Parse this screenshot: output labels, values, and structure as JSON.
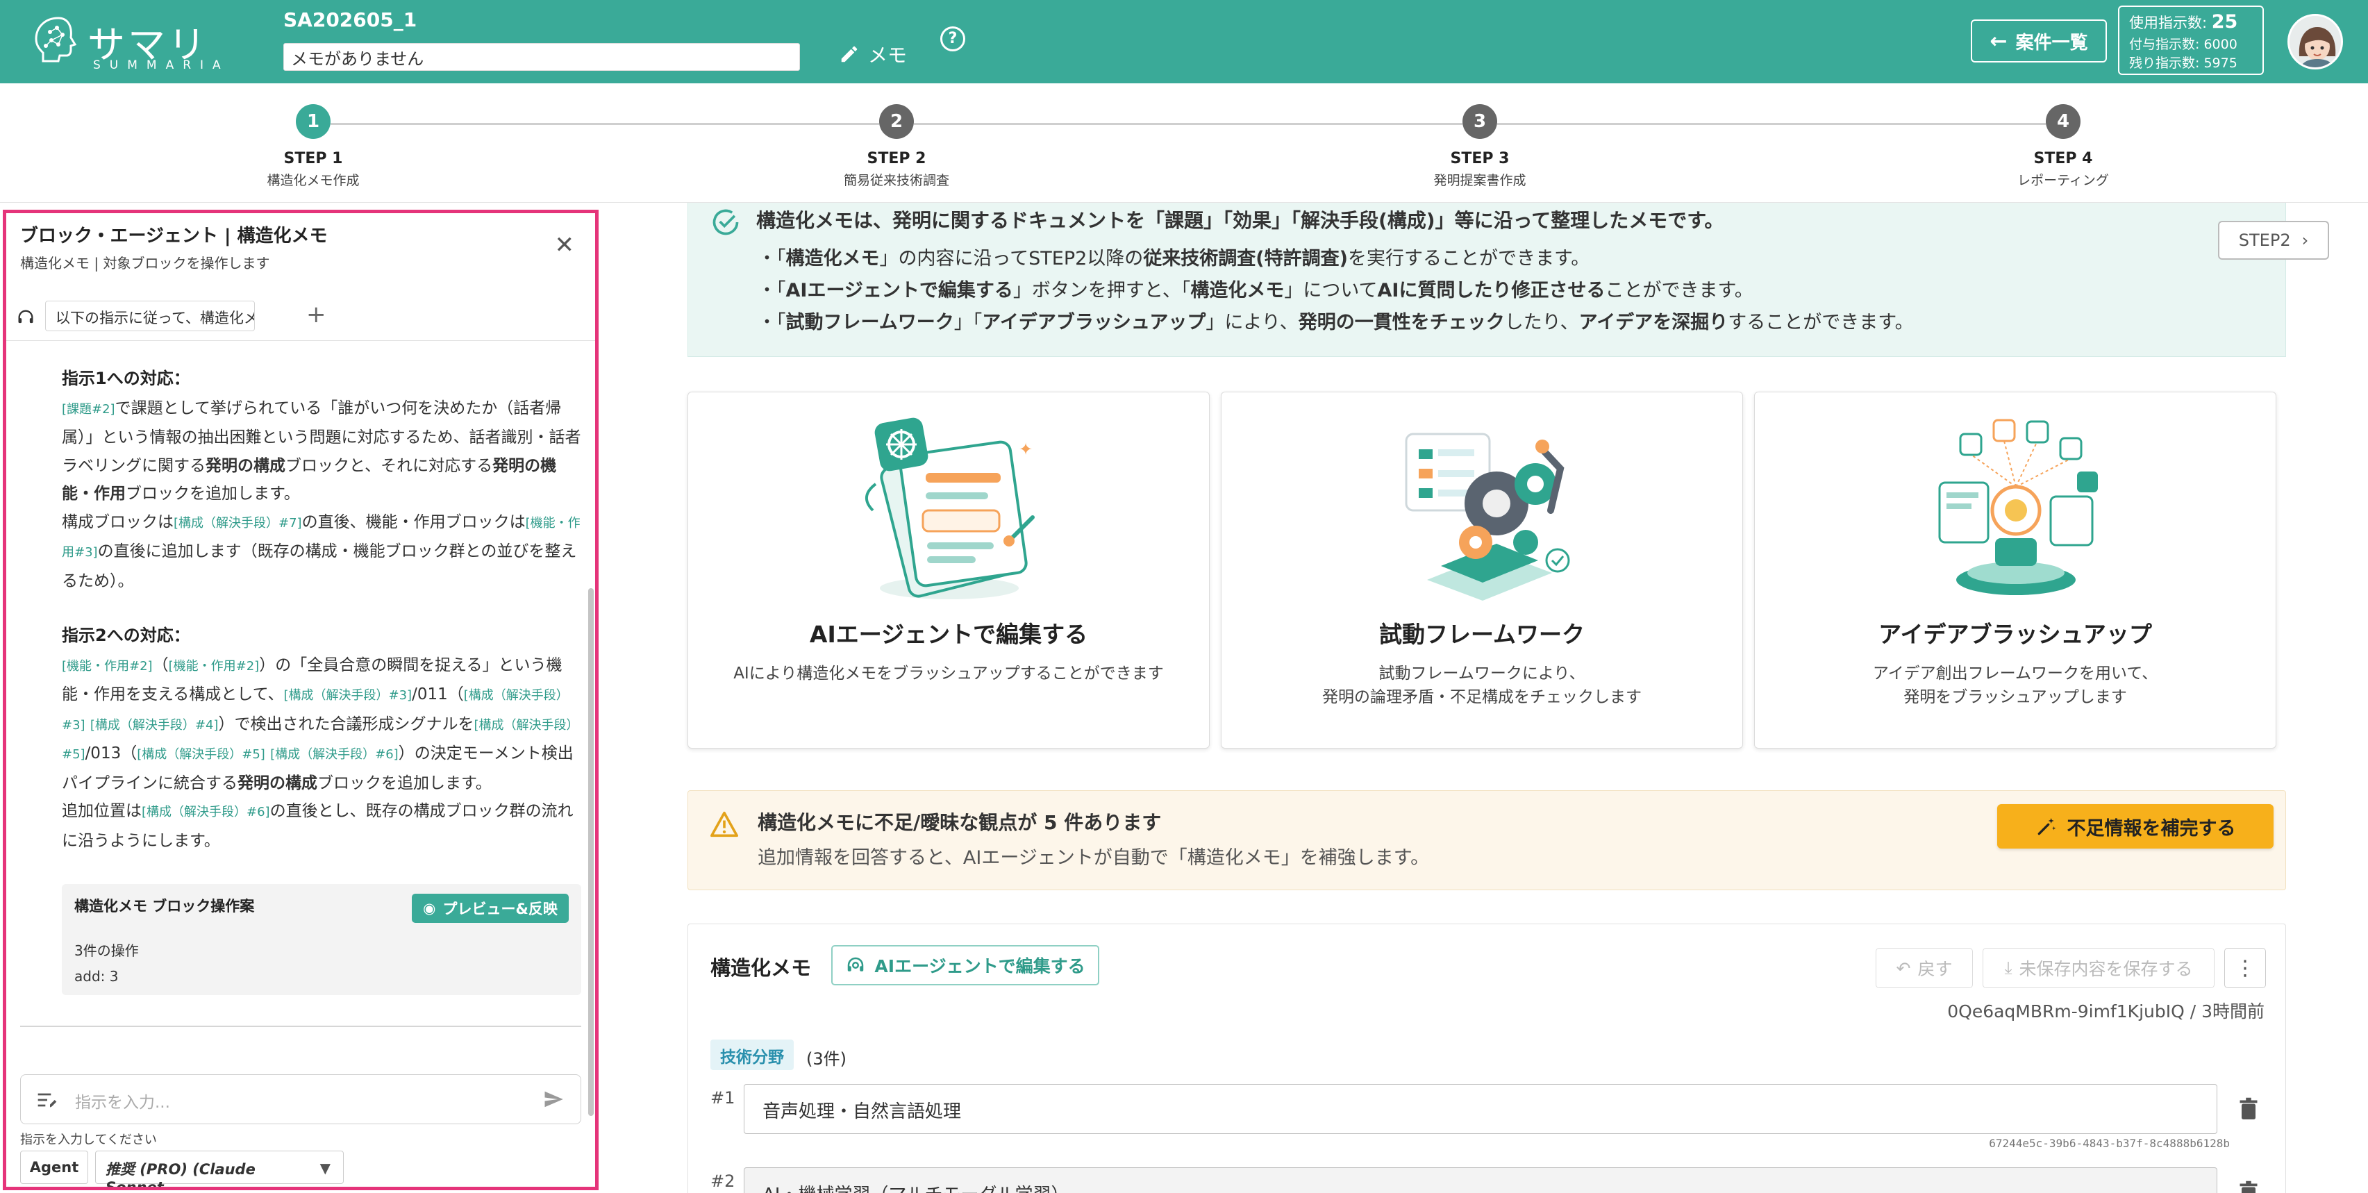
{
  "header": {
    "logo_text": "サマリア",
    "logo_sub": "SUMMARIA",
    "case_id": "SA202605_1",
    "memo_value": "メモがありません",
    "memo_button": "メモ",
    "cases_button": "案件一覧",
    "usage": {
      "used_label": "使用指示数:",
      "used_value": "25",
      "granted": "付与指示数: 6000",
      "remaining": "残り指示数: 5975"
    }
  },
  "steps": [
    {
      "num": "1",
      "title": "STEP 1",
      "sub": "構造化メモ作成"
    },
    {
      "num": "2",
      "title": "STEP 2",
      "sub": "簡易従来技術調査"
    },
    {
      "num": "3",
      "title": "STEP 3",
      "sub": "発明提案書作成"
    },
    {
      "num": "4",
      "title": "STEP 4",
      "sub": "レポーティング"
    }
  ],
  "panel": {
    "title": "ブロック・エージェント | 構造化メモ",
    "subtitle": "構造化メモ | 対象ブロックを操作します",
    "tab_label": "以下の指示に従って、構造化メモ ...",
    "section1": {
      "heading": "指示1への対応：",
      "ref_a": "[課題#2]",
      "text_a": "で課題として挙げられている「誰がいつ何を決めたか（話者帰属）」という情報の抽出困難という問題に対応するため、話者識別・話者ラベリングに関する",
      "bold_a": "発明の構成",
      "text_b": "ブロックと、それに対応する",
      "bold_b": "発明の機能・作用",
      "text_c": "ブロックを追加します。",
      "text_d": "構成ブロックは",
      "ref_b": "[構成（解決手段）#7]",
      "text_e": "の直後、機能・作用ブロックは",
      "ref_c": "[機能・作用#3]",
      "text_f": "の直後に追加します（既存の構成・機能ブロック群との並びを整えるため）。"
    },
    "section2": {
      "heading": "指示2への対応：",
      "ref_a": "[機能・作用#2]",
      "text_a": "（",
      "ref_b": "[機能・作用#2]",
      "text_b": "）の「全員合意の瞬間を捉える」という機能・作用を支える構成として、",
      "ref_c": "[構成（解決手段）#3]",
      "text_c": "/011（",
      "ref_d": "[構成（解決手段）#3]",
      "ref_e": "[構成（解決手段）#4]",
      "text_d": "）で検出された合議形成シグナルを",
      "ref_f": "[構成（解決手段）#5]",
      "text_e": "/013（",
      "ref_g": "[構成（解決手段）#5]",
      "ref_h": "[構成（解決手段）#6]",
      "text_f": "）の決定モーメント検出パイプラインに統合する",
      "bold_a": "発明の構成",
      "text_g": "ブロックを追加します。",
      "text_h": "追加位置は",
      "ref_i": "[構成（解決手段）#6]",
      "text_i": "の直後とし、既存の構成ブロック群の流れに沿うようにします。"
    },
    "op_card": {
      "title": "構造化メモ ブロック操作案",
      "preview_button": "プレビュー&反映",
      "ops_count": "3件の操作",
      "ops_detail": "add: 3"
    },
    "input_placeholder": "指示を入力...",
    "input_hint": "指示を入力してください",
    "agent_button": "Agent",
    "model_value": "推奨 (PRO) (Claude Sonnet..."
  },
  "info": {
    "title": "構造化メモは、発明に関するドキュメントを「課題」「効果」「解決手段(構成)」等に沿って整理したメモです。",
    "line1": {
      "a": "・「",
      "b": "構造化メモ",
      "c": "」の内容に沿ってSTEP2以降の",
      "d": "従来技術調査(特許調査)",
      "e": "を実行することができます。"
    },
    "line2": {
      "a": "・「",
      "b": "AIエージェントで編集する",
      "c": "」ボタンを押すと、「",
      "d": "構造化メモ",
      "e": "」について",
      "f": "AIに質問したり修正させる",
      "g": "ことができます。"
    },
    "line3": {
      "a": "・「",
      "b": "試動フレームワーク",
      "c": "」「",
      "d": "アイデアブラッシュアップ",
      "e": "」により、",
      "f": "発明の一貫性をチェック",
      "g": "したり、",
      "h": "アイデアを深掘り",
      "i": "することができます。"
    },
    "step2_button": "STEP2"
  },
  "cards": [
    {
      "title": "AIエージェントで編集する",
      "desc1": "AIにより構造化メモをブラッシュアップすることができます",
      "desc2": ""
    },
    {
      "title": "試動フレームワーク",
      "desc1": "試動フレームワークにより、",
      "desc2": "発明の論理矛盾・不足構成をチェックします"
    },
    {
      "title": "アイデアブラッシュアップ",
      "desc1": "アイデア創出フレームワークを用いて、",
      "desc2": "発明をブラッシュアップします"
    }
  ],
  "warning": {
    "title": "構造化メモに不足/曖昧な観点が 5 件あります",
    "desc": "追加情報を回答すると、AIエージェントが自動で「構造化メモ」を補強します。",
    "button": "不足情報を補完する"
  },
  "memo": {
    "heading": "構造化メモ",
    "ai_edit_button": "AIエージェントで編集する",
    "back_button": "戻す",
    "save_button": "未保存内容を保存する",
    "version": "0Qe6aqMBRm-9imf1KjubIQ / 3時間前",
    "tag": "技術分野",
    "count": "(3件)",
    "rows": [
      {
        "num": "#1",
        "value": "音声処理・自然言語処理",
        "id": "67244e5c-39b6-4843-b37f-8c4888b6128b"
      },
      {
        "num": "#2",
        "value": "AI・機械学習（マルチモーダル学習）",
        "id": ""
      }
    ]
  },
  "colors": {
    "brand": "#3aaa98",
    "panel_border": "#e5347a",
    "warning_button": "#f7b01b"
  }
}
